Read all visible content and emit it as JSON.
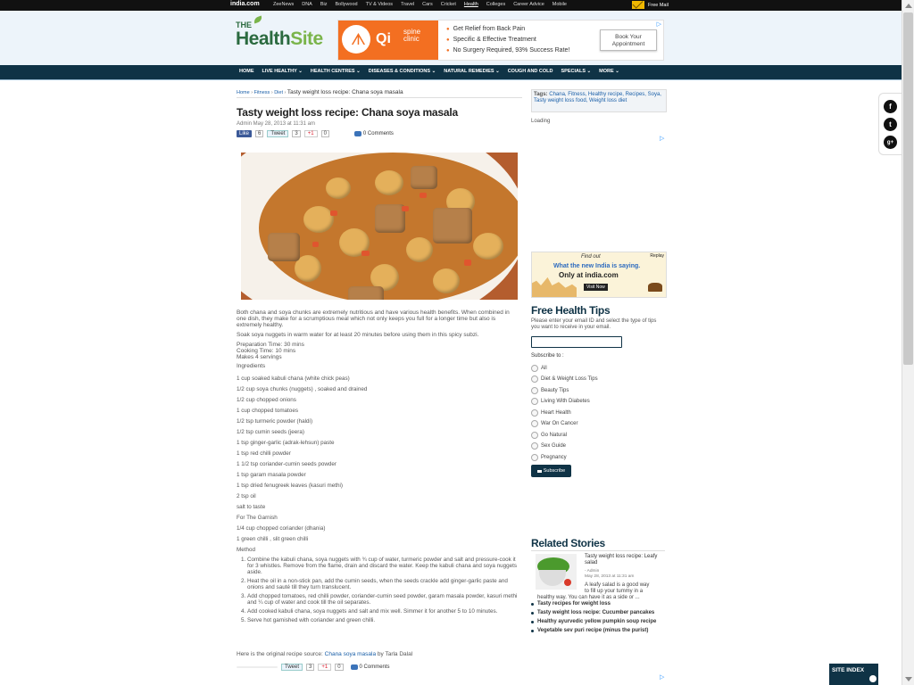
{
  "topbar": {
    "logo": "india.com",
    "links": [
      "ZeeNews",
      "DNA",
      "Biz",
      "Bollywood",
      "TV & Videos",
      "Travel",
      "Cars",
      "Cricket",
      "Health",
      "Colleges",
      "Career Advice",
      "Mobile"
    ],
    "active_link": "Health",
    "mail_label": "Free Mail",
    "colors": {
      "bg": "#111111",
      "mail_icon": "#f1b800"
    }
  },
  "header": {
    "logo_the": "THE",
    "logo_name_part1": "Health",
    "logo_name_part2": "Site",
    "ad": {
      "brand": "Qi",
      "brand_sub1": "spine",
      "brand_sub2": "clinic",
      "bullets": [
        "Get Relief from Back Pain",
        "Specific & Effective Treatment",
        "No Surgery Required, 93% Success Rate!"
      ],
      "cta": "Book Your Appointment"
    }
  },
  "nav": {
    "items": [
      "HOME",
      "LIVE HEALTHY ⌄",
      "HEALTH CENTRES ⌄",
      "DISEASES & CONDITIONS ⌄",
      "NATURAL REMEDIES ⌄",
      "COUGH AND COLD",
      "SPECIALS ⌄",
      "MORE ⌄"
    ],
    "colors": {
      "bg": "#0f3346"
    }
  },
  "article": {
    "breadcrumb": {
      "home": "Home",
      "sep": " › ",
      "cat1": "Fitness",
      "cat2": "Diet",
      "current": "Tasty weight loss recipe: Chana soya masala"
    },
    "title": "Tasty weight loss recipe: Chana soya masala",
    "meta": "Admin May 28, 2013 at 11:31 am",
    "social": {
      "like": "Like",
      "like_count": "6",
      "tweet": "Tweet",
      "tweet_count": "3",
      "gplus": "+1",
      "gplus_count": "0",
      "comments": "0 Comments"
    },
    "intro": "Both chana and soya chunks are extremely nutritious and have various health benefits. When combined in one dish, they make for a scrumptious meal which not only keeps you full for a longer time but also is extremely healthy.",
    "soak": "Soak soya nuggets in warm water for at least 20 minutes before using them in this spicy subzi.",
    "prep": "Preparation Time: 30 mins",
    "cook": "Cooking Time: 10 mins",
    "serves": "Makes 4 servings",
    "ingredients_label": "Ingredients",
    "ingredients": [
      "1 cup soaked kabuli chana (white chick peas)",
      "1/2 cup soya chunks (nuggets) , soaked and drained",
      "1/2 cup chopped onions",
      "1 cup chopped tomatoes",
      "1/2 tsp turmeric powder (haldi)",
      "1/2 tsp cumin seeds (jeera)",
      "1 tsp ginger-garlic (adrak-lehsun) paste",
      "1 tsp red chilli powder",
      "1 1/2 tsp coriander-cumin seeds powder",
      "1 tsp garam masala powder",
      "1 tsp dried fenugreek leaves (kasuri methi)",
      "2 tsp oil",
      "salt to taste",
      "For The Garnish",
      "1/4 cup chopped coriander (dhania)",
      "1 green chilli , slit green chilli"
    ],
    "method_label": "Method",
    "method": [
      "Combine the kabuli chana, soya nuggets with ¾ cup of water, turmeric powder and salt and pressure-cook it for 3 whistles. Remove from the flame, drain and discard the water. Keep the kabuli chana and soya nuggets aside.",
      "Heat the oil in a non-stick pan, add the cumin seeds, when the seeds crackle add ginger-garlic paste and onions and sauté till they turn translucent.",
      "Add chopped tomatoes, red chilli powder, coriander-cumin seed powder, garam masala powder, kasuri methi and ¼ cup of water and cook till the oil separates.",
      "Add cooked kabuli chana, soya nuggets and salt and mix well. Simmer it for another 5 to 10 minutes.",
      "Serve hot garnished with coriander and green chilli."
    ],
    "source_prefix": "Here is the original recipe source: ",
    "source_link": "Chana soya masala",
    "source_suffix": " by Tarla Dalal"
  },
  "sidebar": {
    "tags_label": "Tags:",
    "tags": "Chana, Fitness, Healthy recipe, Recipes, Soya, Tasty weight loss food, Weight loss diet",
    "loading": "Loading",
    "india_ad": {
      "line1": "Find out",
      "line2": "What the new India is saying.",
      "line3": "Only at india.com",
      "visit": "Visit Now",
      "replay": "Replay"
    },
    "fht": {
      "title": "Free Health Tips",
      "desc": "Please enter your email ID and select the type of tips you want to receive in your email.",
      "subscribe_to": "Subscribe to :",
      "options": [
        "All",
        "Diet & Weight Loss Tips",
        "Beauty Tips",
        "Living With Diabetes",
        "Heart Health",
        "War On Cancer",
        "Go Natural",
        "Sex Guide",
        "Pregnancy"
      ],
      "button": "Subscribe"
    },
    "related": {
      "title": "Related Stories",
      "main_title": "Tasty weight loss recipe: Leafy salad",
      "main_author": "- Admin",
      "main_date": "May 28, 2013 at 11:31 am",
      "main_desc_1": "A leafy salad is a good way",
      "main_desc_2": "to fill up your tummy in a",
      "main_desc_3": "healthy way. You can have it as a side or ...",
      "list": [
        "Tasty recipes for weight loss",
        "Tasty weight loss recipe: Cucumber pancakes",
        "Healthy ayurvedic yellow pumpkin soup recipe",
        "Vegetable sev puri recipe (minus the purist)"
      ]
    }
  },
  "share_panel": {
    "facebook": "f",
    "twitter": "t",
    "gplus": "g+"
  },
  "site_index": "SITE INDEX"
}
